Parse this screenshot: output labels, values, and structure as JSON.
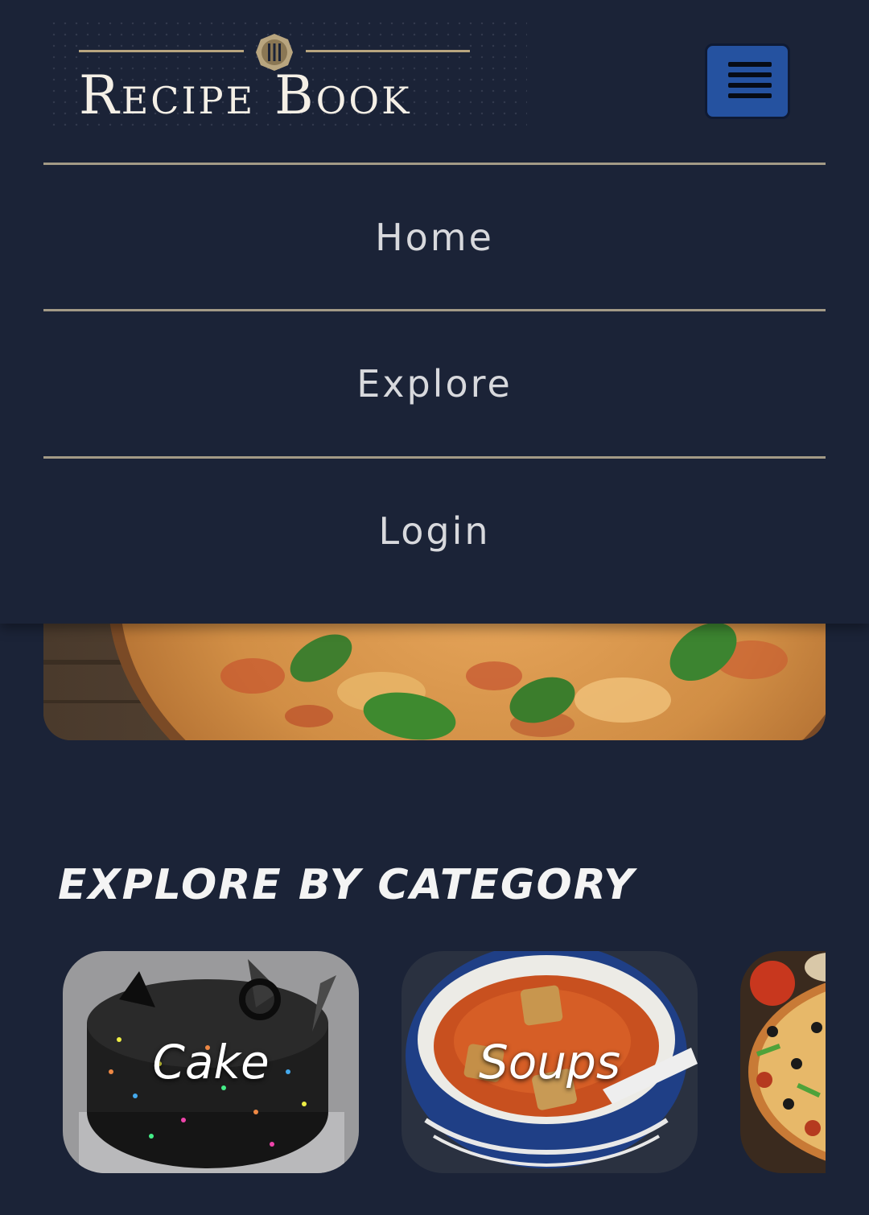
{
  "header": {
    "logo_text": "Recipe Book",
    "menu_button_icon": "hamburger-menu-icon",
    "logo_emblem_icon": "fork-knife-emblem-icon"
  },
  "nav": {
    "items": [
      {
        "label": "Home"
      },
      {
        "label": "Explore"
      },
      {
        "label": "Login"
      }
    ]
  },
  "hero": {
    "image": "pizza-photo"
  },
  "categories": {
    "title": "EXPLORE BY CATEGORY",
    "items": [
      {
        "label": "Cake",
        "image": "chocolate-cake-photo"
      },
      {
        "label": "Soups",
        "image": "tomato-soup-photo"
      },
      {
        "label": "",
        "image": "pizza-photo"
      }
    ]
  },
  "colors": {
    "background": "#1b2337",
    "accent_gold": "#b8a57f",
    "menu_button": "#2552a0",
    "nav_text": "#d8d9dd"
  }
}
